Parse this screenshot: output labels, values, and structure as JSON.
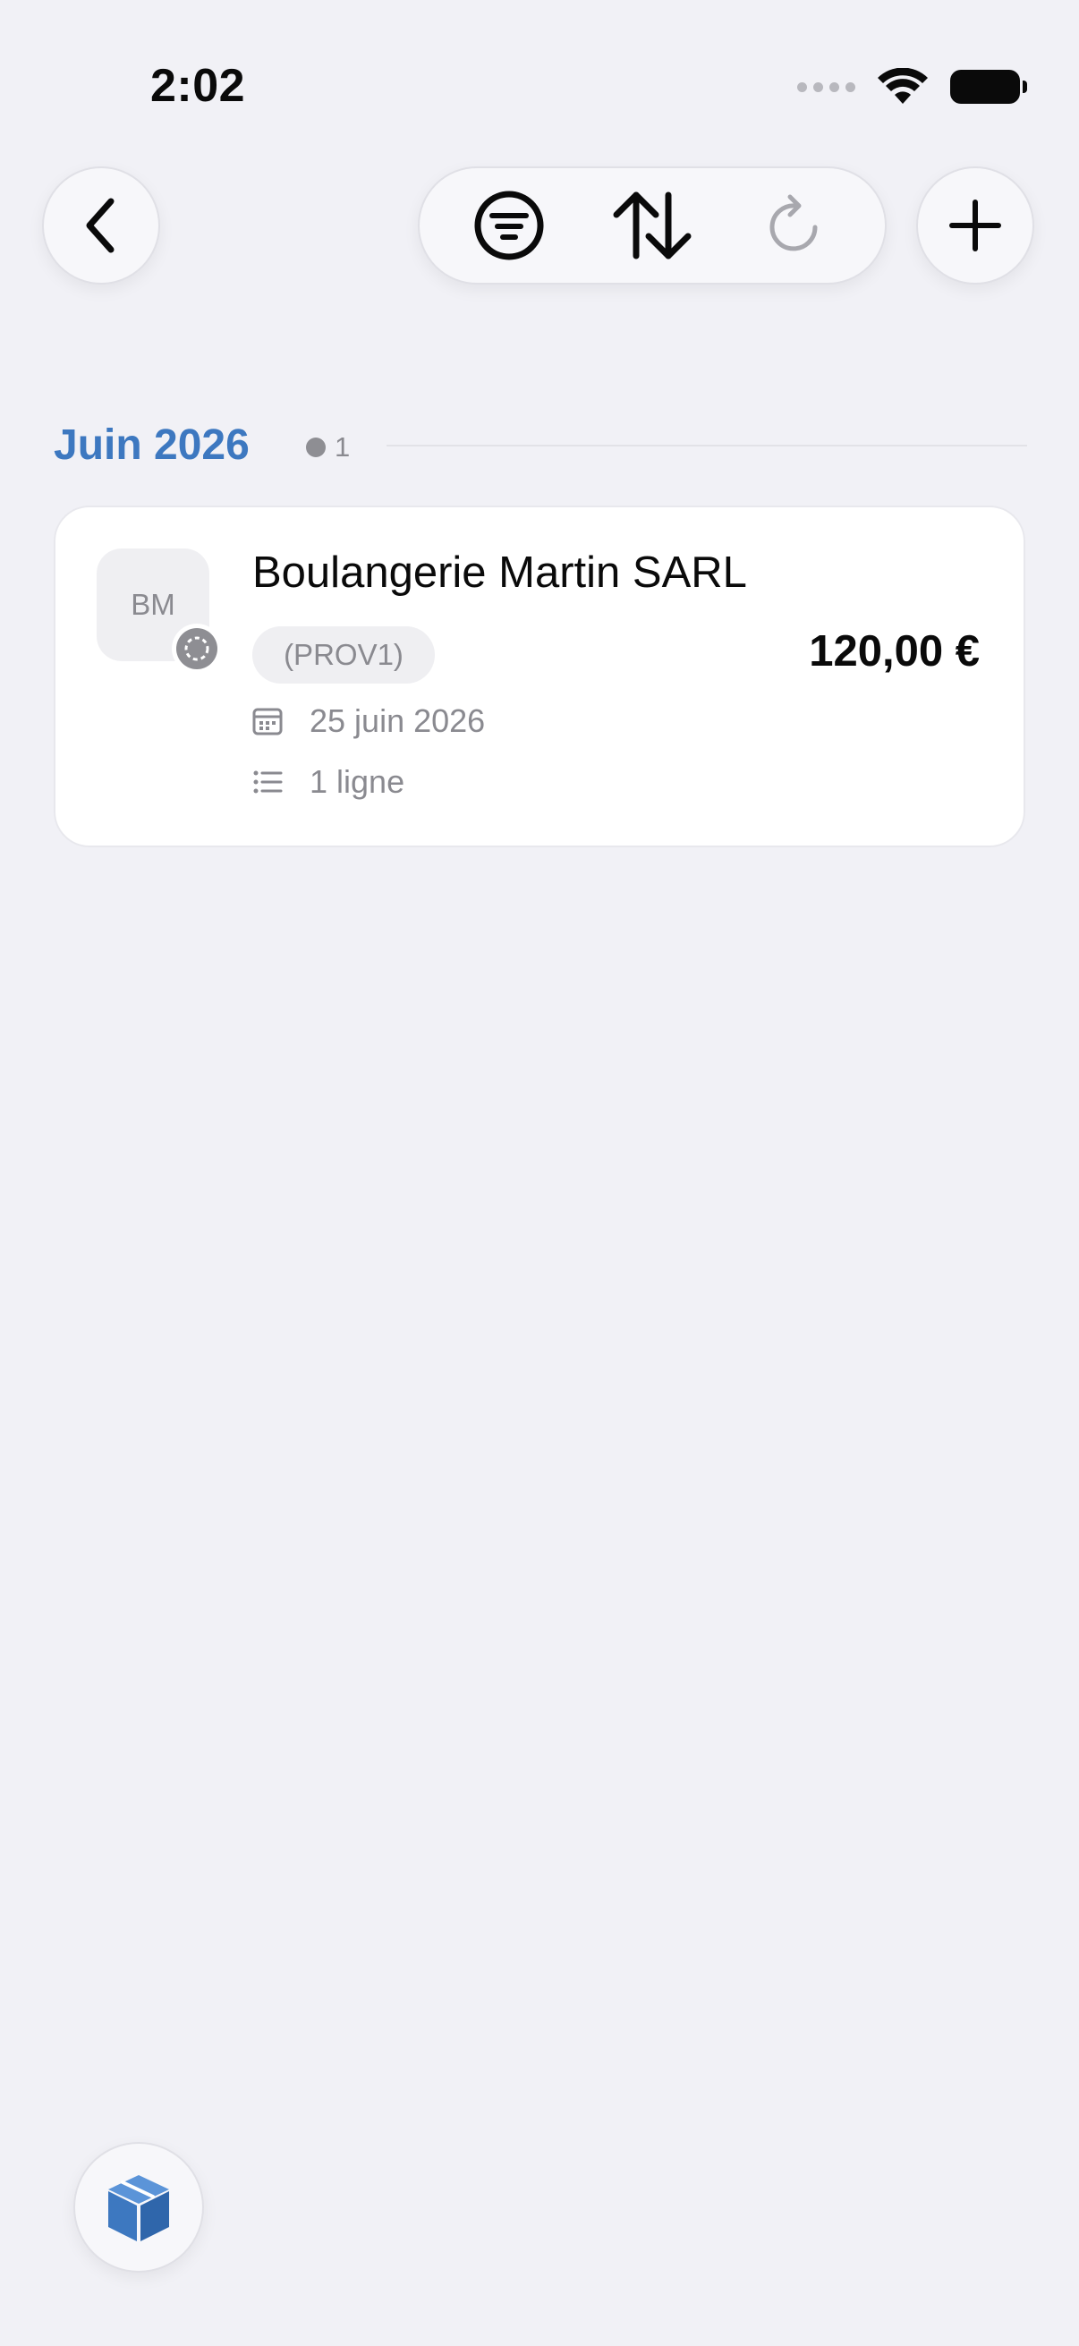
{
  "status_bar": {
    "time": "2:02"
  },
  "toolbar": {
    "back_icon": "chevron-left-icon",
    "filter_icon": "filter-icon",
    "sort_icon": "sort-arrows-icon",
    "refresh_icon": "refresh-icon",
    "add_icon": "plus-icon"
  },
  "section": {
    "title": "Juin 2026",
    "count": "1"
  },
  "items": [
    {
      "initials": "BM",
      "name": "Boulangerie Martin SARL",
      "tag": "(PROV1)",
      "amount": "120,00 €",
      "date": "25 juin 2026",
      "lines": "1 ligne"
    }
  ],
  "colors": {
    "accent": "#3d78c0",
    "background": "#f1f1f6",
    "secondary_text": "#8a8a90"
  },
  "bottom_button_icon": "box-icon"
}
